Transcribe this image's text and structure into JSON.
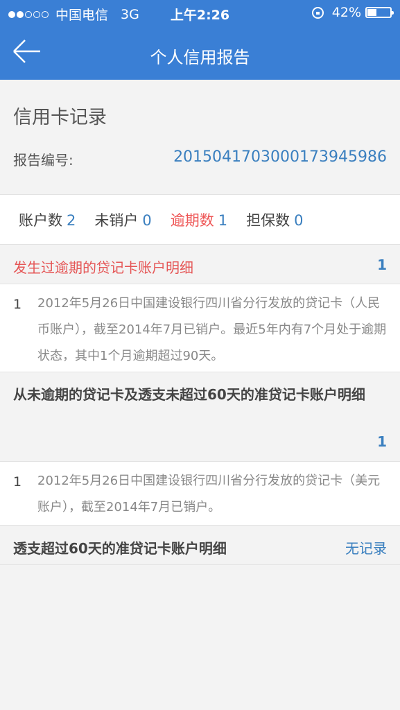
{
  "status_bar": {
    "carrier": "中国电信",
    "network": "3G",
    "time": "上午2:26",
    "battery_percent_text": "42%",
    "battery_level": 0.42,
    "signal_dots_filled": 2,
    "signal_dots_total": 5
  },
  "nav": {
    "title": "个人信用报告",
    "back_icon": "back-arrow-icon"
  },
  "header": {
    "section_title": "信用卡记录",
    "report_label": "报告编号:",
    "report_number": "2015041703000173945986"
  },
  "stats": [
    {
      "label": "账户数",
      "value": "2"
    },
    {
      "label": "未销户",
      "value": "0"
    },
    {
      "label": "逾期数",
      "value": "1"
    },
    {
      "label": "担保数",
      "value": "0"
    }
  ],
  "groups": {
    "overdue": {
      "title": "发生过逾期的贷记卡账户明细",
      "count": "1",
      "items": [
        {
          "index": "1",
          "text": "2012年5月26日中国建设银行四川省分行发放的贷记卡（人民币账户），截至2014年7月已销户。最近5年内有7个月处于逾期状态，其中1个月逾期超过90天。"
        }
      ]
    },
    "never_overdue": {
      "title": "从未逾期的贷记卡及透支未超过60天的准贷记卡账户明细",
      "count": "1",
      "items": [
        {
          "index": "1",
          "text": "2012年5月26日中国建设银行四川省分行发放的贷记卡（美元账户），截至2014年7月已销户。"
        }
      ]
    },
    "overdraft": {
      "title": "透支超过60天的准贷记卡账户明细",
      "status": "无记录"
    }
  },
  "colors": {
    "brand_blue": "#3a7fd5",
    "link_blue": "#3a7fbf",
    "alert_red": "#e55555"
  }
}
